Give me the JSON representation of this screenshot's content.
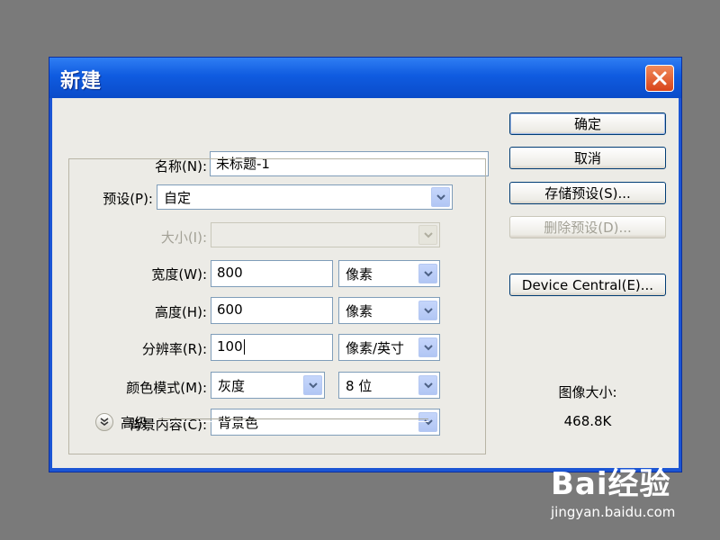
{
  "dialog": {
    "title": "新建",
    "close_label": "✕"
  },
  "form": {
    "name": {
      "label": "名称(N):",
      "value": "未标题-1"
    },
    "preset": {
      "label": "预设(P):",
      "value": "自定"
    },
    "size": {
      "label": "大小(I):",
      "value": ""
    },
    "width": {
      "label": "宽度(W):",
      "value": "800",
      "unit": "像素"
    },
    "height": {
      "label": "高度(H):",
      "value": "600",
      "unit": "像素"
    },
    "resolution": {
      "label": "分辨率(R):",
      "value": "100",
      "unit": "像素/英寸"
    },
    "color_mode": {
      "label": "颜色模式(M):",
      "value": "灰度",
      "depth": "8 位"
    },
    "background": {
      "label": "背景内容(C):",
      "value": "背景色"
    },
    "advanced_label": "高级"
  },
  "buttons": {
    "ok": "确定",
    "cancel": "取消",
    "save_preset": "存储预设(S)...",
    "delete_preset": "删除预设(D)...",
    "device_central": "Device Central(E)..."
  },
  "info": {
    "image_size_label": "图像大小:",
    "image_size_value": "468.8K"
  },
  "watermark": {
    "logo": "Bai经验",
    "url": "jingyan.baidu.com"
  }
}
